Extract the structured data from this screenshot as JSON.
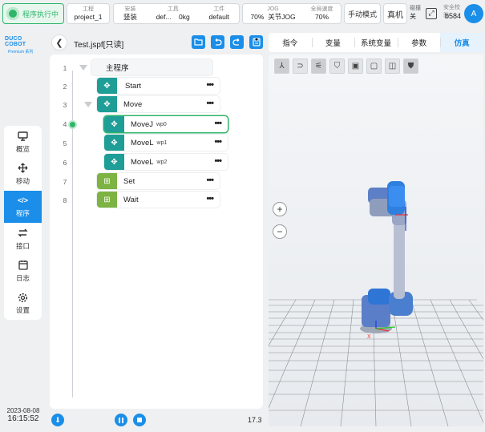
{
  "status": {
    "run_label": "程序执行中",
    "project_key": "工程",
    "project_val": "project_1",
    "install_key": "安装",
    "install_val": "竖装",
    "tool_key": "工具",
    "tool_val_a": "def...",
    "tool_val_b": "0kg",
    "workpiece_key": "工件",
    "workpiece_val": "default",
    "jog_key": "JOG",
    "jog_val_a": "70%",
    "jog_val_b": "关节JOG",
    "speed_key": "全局速度",
    "speed_val": "70%",
    "mode_label": "手动模式",
    "real_label": "真机",
    "brake_key": "碰撞",
    "brake_val": "关",
    "safety_key": "安全校验",
    "safety_val": "b584",
    "avatar": "A"
  },
  "logo": {
    "brand": "DUCO COBOT",
    "edition": "Premium 系列"
  },
  "nav": [
    {
      "label": "概览",
      "icon": "monitor-icon"
    },
    {
      "label": "移动",
      "icon": "move-icon"
    },
    {
      "label": "程序",
      "icon": "code-icon",
      "active": true
    },
    {
      "label": "接口",
      "icon": "swap-icon"
    },
    {
      "label": "日志",
      "icon": "calendar-icon"
    },
    {
      "label": "设置",
      "icon": "gear-icon"
    }
  ],
  "datetime": {
    "date": "2023-08-08",
    "time": "16:15:52"
  },
  "program": {
    "title": "Test.jspf[只读]",
    "progress": "17.3",
    "tree": [
      {
        "line": "1",
        "label": "主程序"
      },
      {
        "line": "2",
        "label": "Start"
      },
      {
        "line": "3",
        "label": "Move"
      },
      {
        "line": "4",
        "label": "MoveJ",
        "wp": "wp0"
      },
      {
        "line": "5",
        "label": "MoveL",
        "wp": "wp1"
      },
      {
        "line": "6",
        "label": "MoveL",
        "wp": "wp2"
      },
      {
        "line": "7",
        "label": "Set"
      },
      {
        "line": "8",
        "label": "Wait"
      }
    ]
  },
  "tabs": [
    "指令",
    "变量",
    "系统变量",
    "参数",
    "仿真"
  ],
  "sim": {
    "x_axis_label": "X"
  },
  "colors": {
    "accent": "#1a8ee8",
    "run_green": "#2fb56a",
    "node_teal": "#1e9e96",
    "node_green": "#7cb342"
  }
}
